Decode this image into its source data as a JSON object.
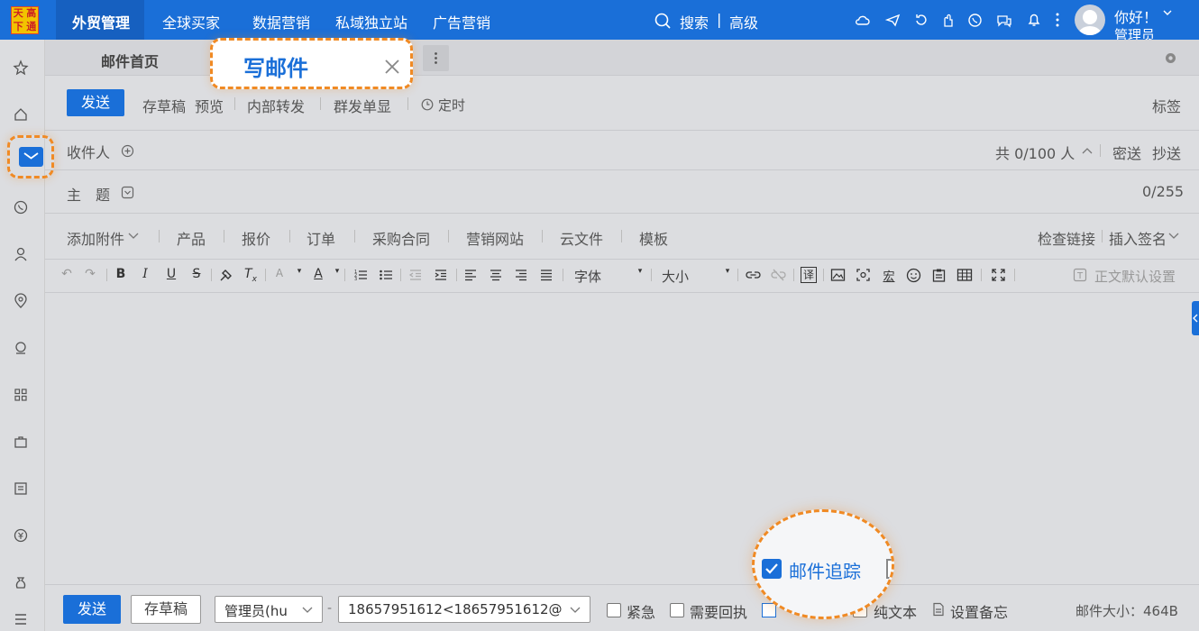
{
  "logo": {
    "chars": [
      "天",
      "高",
      "下",
      "通"
    ]
  },
  "topnav": {
    "items": [
      "外贸管理",
      "全球买家",
      "数据营销",
      "私域独立站",
      "广告营销"
    ],
    "search_label": "搜索",
    "search_sep": "|",
    "advanced_label": "高级",
    "greeting": "你好！",
    "user_role": "管理员"
  },
  "tabs": {
    "home": "邮件首页",
    "compose": "写邮件"
  },
  "toolbar": {
    "send": "发送",
    "save_draft": "存草稿",
    "preview": "预览",
    "internal_forward": "内部转发",
    "group_single": "群发单显",
    "scheduled": "定时",
    "tags": "标签"
  },
  "recipient": {
    "label": "收件人",
    "count": "共 0/100 人",
    "bcc": "密送",
    "cc": "抄送"
  },
  "subject": {
    "label": "主　题",
    "count": "0/255"
  },
  "attachments": {
    "add_attachment": "添加附件",
    "items": [
      "产品",
      "报价",
      "订单",
      "采购合同",
      "营销网站",
      "云文件",
      "模板"
    ],
    "check_links": "检查链接",
    "insert_signature": "插入签名"
  },
  "editor": {
    "font": "字体",
    "size": "大小",
    "translate": "译",
    "macro": "宏",
    "default_settings": "正文默认设置"
  },
  "footer": {
    "send": "发送",
    "save_draft": "存草稿",
    "sender_name": "管理员(hu",
    "dash": "-",
    "sender_email": "18657951612<18657951612@",
    "urgent": "紧急",
    "receipt": "需要回执",
    "tracking": "邮件追踪",
    "plain_text": "纯文本",
    "memo": "设置备忘",
    "size_label": "邮件大小：464B"
  }
}
